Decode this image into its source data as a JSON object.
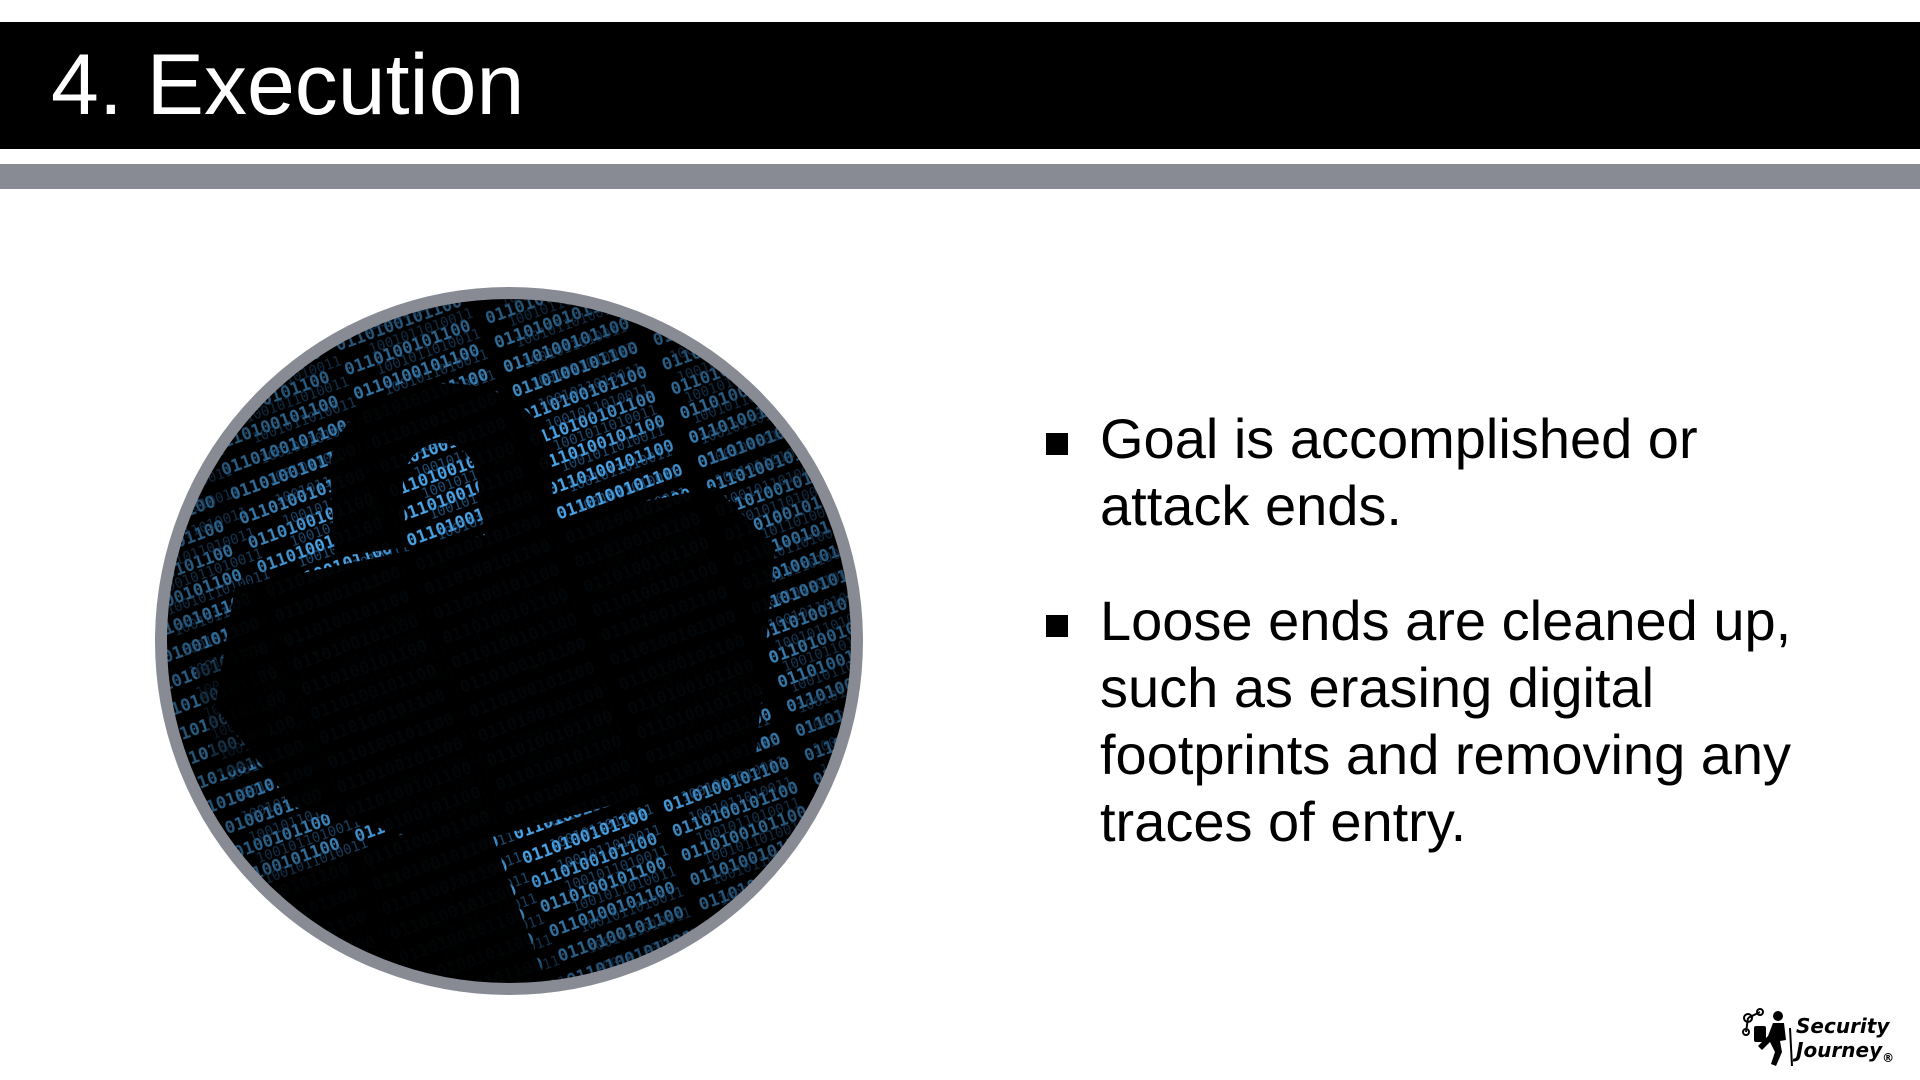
{
  "slide": {
    "title": "4. Execution"
  },
  "image": {
    "icon": "padlock-binary-code-icon",
    "border_color": "#898b94",
    "digit_color": "#4aa3e6"
  },
  "bullets": [
    {
      "text": "Goal is accomplished or attack ends."
    },
    {
      "text": "Loose ends are cleaned up, such as erasing digital footprints and removing any traces of entry."
    }
  ],
  "logo": {
    "line1": "Security",
    "line2": "Journey",
    "registered": "®"
  },
  "colors": {
    "title_bar": "#000000",
    "accent_rule": "#898b94",
    "text": "#000000"
  }
}
